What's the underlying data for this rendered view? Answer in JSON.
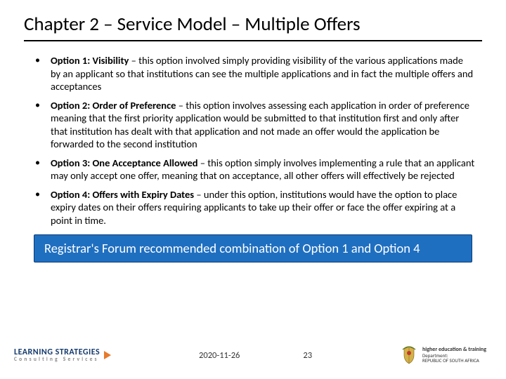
{
  "title": "Chapter 2 – Service Model – Multiple Offers",
  "bullets": [
    {
      "label": "Option 1:  Visibility",
      "text": " – this option involved simply providing visibility of the various applications made by an applicant so that institutions can see the multiple applications and in fact the multiple offers and acceptances"
    },
    {
      "label": "Option 2:  Order of Preference",
      "text": " – this option involves assessing each application in order of preference meaning that the first priority application would be submitted to that institution first and only after that institution has dealt with that application and not made an offer would the application be forwarded to the second institution"
    },
    {
      "label": "Option 3:  One Acceptance Allowed",
      "text": " – this option simply involves implementing a rule that an applicant may only accept one offer, meaning that on acceptance, all other offers will effectively be rejected"
    },
    {
      "label": "Option 4:  Offers with Expiry Dates",
      "text": " – under this option, institutions would have the option to place expiry dates on their offers requiring applicants to take up their offer or face the offer expiring at a point in time."
    }
  ],
  "banner": "Registrar's Forum recommended combination of Option 1 and Option 4",
  "footer": {
    "date": "2020-11-26",
    "page": "23",
    "left_logo": {
      "line1": "LEARNING STRATEGIES",
      "line2": "Consulting Services"
    },
    "right_logo": {
      "line1": "Department:",
      "line2": "higher education & training",
      "line3": "REPUBLIC OF SOUTH AFRICA"
    }
  }
}
